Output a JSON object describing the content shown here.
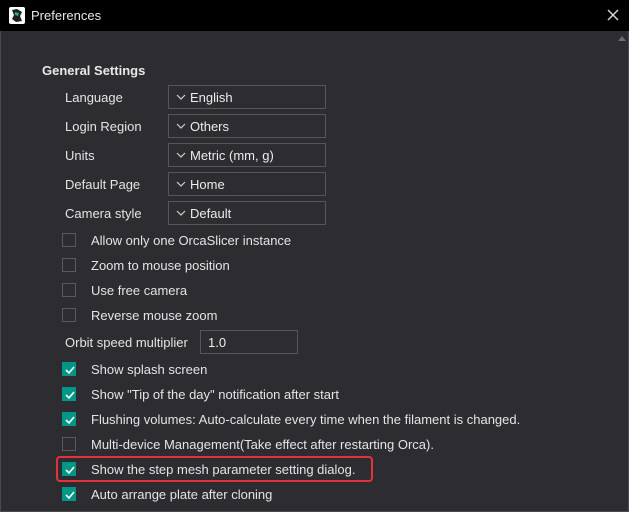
{
  "window": {
    "title": "Preferences"
  },
  "general": {
    "section_title": "General Settings",
    "settings": [
      {
        "label": "Language",
        "value": "English"
      },
      {
        "label": "Login Region",
        "value": "Others"
      },
      {
        "label": "Units",
        "value": "Metric (mm, g)"
      },
      {
        "label": "Default Page",
        "value": "Home"
      },
      {
        "label": "Camera style",
        "value": "Default"
      }
    ],
    "checks_a": [
      {
        "label": "Allow only one OrcaSlicer instance",
        "checked": false
      },
      {
        "label": "Zoom to mouse position",
        "checked": false
      },
      {
        "label": "Use free camera",
        "checked": false
      },
      {
        "label": "Reverse mouse zoom",
        "checked": false
      }
    ],
    "orbit": {
      "label": "Orbit speed multiplier",
      "value": "1.0"
    },
    "checks_b": [
      {
        "label": "Show splash screen",
        "checked": true
      },
      {
        "label": "Show \"Tip of the day\" notification after start",
        "checked": true
      },
      {
        "label": "Flushing volumes: Auto-calculate every time when the filament is changed.",
        "checked": true
      },
      {
        "label": "Multi-device Management(Take effect after restarting Orca).",
        "checked": false
      },
      {
        "label": "Show the step mesh parameter setting dialog.",
        "checked": true
      },
      {
        "label": "Auto arrange plate after cloning",
        "checked": true
      }
    ]
  },
  "colors": {
    "accent": "#009688",
    "highlight": "#e3323b",
    "background": "#2d2d31",
    "titlebar": "#000000"
  },
  "icons": {
    "app": "orca-slicer-icon",
    "close": "close-icon",
    "combo": "chevron-down-icon",
    "check": "checkmark-icon"
  }
}
